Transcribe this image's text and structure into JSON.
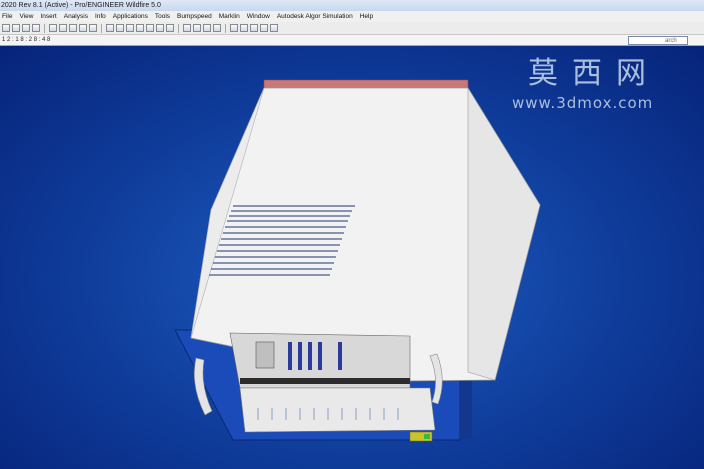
{
  "window": {
    "title": "2020 Rev 8.1 (Active) - Pro/ENGINEER Wildfire 5.0"
  },
  "menu": {
    "items": [
      "File",
      "View",
      "Insert",
      "Analysis",
      "Info",
      "Applications",
      "Tools",
      "Bumpspeed",
      "Marklin",
      "Window",
      "Autodesk Algor Simulation",
      "Help"
    ]
  },
  "status": {
    "text": "1 2 : 1 8 : 2 8 : 4 8"
  },
  "search": {
    "label": "arch"
  },
  "watermark": {
    "chinese": "莫西网",
    "url": "www.3dmox.com"
  },
  "colors": {
    "viewport_bg": "#0f3c9a",
    "model_body": "#f2f2f2",
    "front_panel": "#1a4bb8",
    "top_strip": "#c87878"
  },
  "icons": [
    "new-icon",
    "open-icon",
    "save-icon",
    "print-icon",
    "cut-icon",
    "copy-icon",
    "paste-icon",
    "undo-icon",
    "redo-icon",
    "regenerate-icon",
    "zoom-in-icon",
    "zoom-out-icon",
    "refit-icon",
    "repaint-icon",
    "orient-icon",
    "spin-icon",
    "datum-plane-icon",
    "datum-axis-icon",
    "datum-point-icon",
    "coord-sys-icon",
    "wireframe-icon",
    "hidden-line-icon",
    "no-hidden-icon",
    "shading-icon",
    "help-icon"
  ]
}
